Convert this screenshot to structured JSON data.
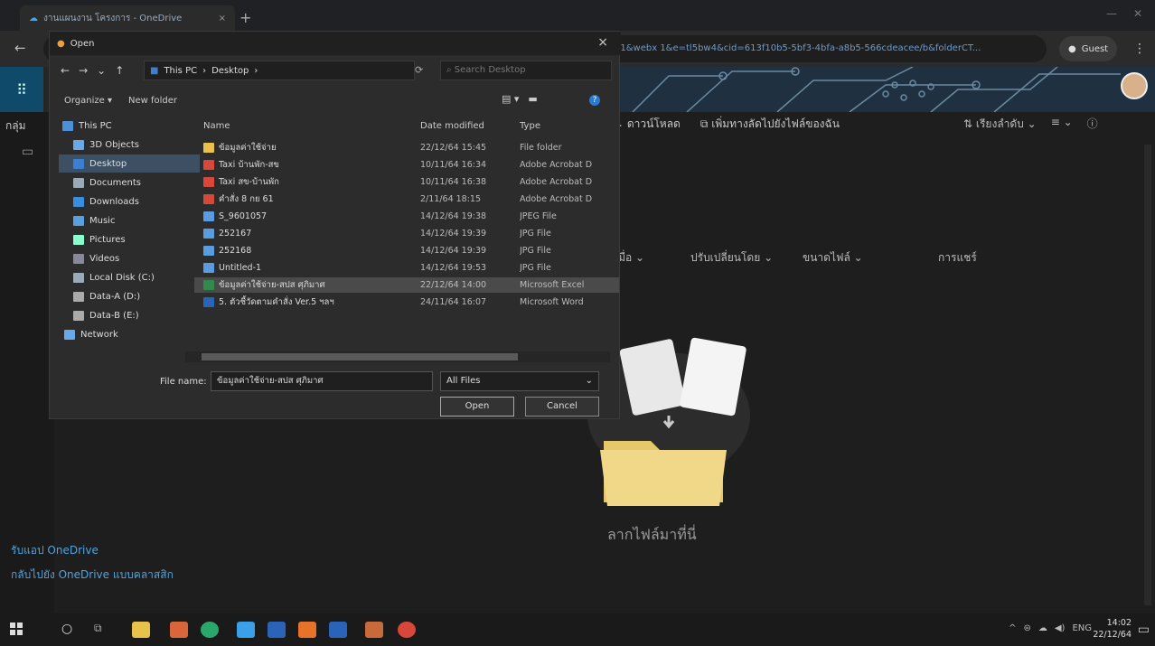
{
  "browser": {
    "tab_title": "งานแผนงาน โครงการ - OneDrive",
    "tab_close": "×",
    "new_tab": "+",
    "address_tail": "=1&webx 1&e=tl5bw4&cid=613f10b5-5bf3-4bfa-a8b5-566cdeacee/b&folderCT...",
    "guest_label": "Guest"
  },
  "onedrive": {
    "groups_label": "กลุ่ม",
    "commands": [
      "ดาวน์โหลด",
      "เพิ่มทางลัดไปยังไฟล์ของฉัน"
    ],
    "sort_label": "เรียงลำดับ",
    "columns": [
      "เมื่อ",
      "ปรับเปลี่ยนโดย",
      "ขนาดไฟล์",
      "การแชร์"
    ],
    "get_app": "รับแอป OneDrive",
    "classic": "กลับไปยัง OneDrive แบบคลาสสิก",
    "drop_here": "ลากไฟล์มาที่นี่"
  },
  "dialog": {
    "title": "Open",
    "close": "×",
    "path": [
      "This PC",
      "Desktop"
    ],
    "search_placeholder": "Search Desktop",
    "organize": "Organize",
    "new_folder": "New folder",
    "help": "?",
    "nav": [
      {
        "label": "This PC",
        "color": "#4f8fd8"
      },
      {
        "label": "3D Objects",
        "color": "#6aa8e8"
      },
      {
        "label": "Desktop",
        "color": "#3c7fd0"
      },
      {
        "label": "Documents",
        "color": "#9ab"
      },
      {
        "label": "Downloads",
        "color": "#3a8ee0"
      },
      {
        "label": "Music",
        "color": "#5aa0e0"
      },
      {
        "label": "Pictures",
        "color": "#8fc"
      },
      {
        "label": "Videos",
        "color": "#889"
      },
      {
        "label": "Local Disk (C:)",
        "color": "#9ab"
      },
      {
        "label": "Data-A (D:)",
        "color": "#aaa"
      },
      {
        "label": "Data-B (E:)",
        "color": "#aaa"
      },
      {
        "label": "Network",
        "color": "#6aa8e8"
      }
    ],
    "headers": {
      "name": "Name",
      "date": "Date modified",
      "type": "Type"
    },
    "files": [
      {
        "name": "ข้อมูลค่าใช้จ่าย",
        "date": "22/12/64 15:45",
        "type": "File folder",
        "icon": "#e8c24a"
      },
      {
        "name": "Taxi บ้านพัก-สข",
        "date": "10/11/64 16:34",
        "type": "Adobe Acrobat D",
        "icon": "#d9463a"
      },
      {
        "name": "Taxi สข-บ้านพัก",
        "date": "10/11/64 16:38",
        "type": "Adobe Acrobat D",
        "icon": "#d9463a"
      },
      {
        "name": "คำสั่ง 8 กย 61",
        "date": "2/11/64 18:15",
        "type": "Adobe Acrobat D",
        "icon": "#d9463a"
      },
      {
        "name": "S_9601057",
        "date": "14/12/64 19:38",
        "type": "JPEG File",
        "icon": "#5b9be0"
      },
      {
        "name": "252167",
        "date": "14/12/64 19:39",
        "type": "JPG File",
        "icon": "#5b9be0"
      },
      {
        "name": "252168",
        "date": "14/12/64 19:39",
        "type": "JPG File",
        "icon": "#5b9be0"
      },
      {
        "name": "Untitled-1",
        "date": "14/12/64 19:53",
        "type": "JPG File",
        "icon": "#5b9be0"
      },
      {
        "name": "ข้อมูลค่าใช้จ่าย-สปส ศุภิมาศ",
        "date": "22/12/64 14:00",
        "type": "Microsoft Excel",
        "icon": "#2f8a4c"
      },
      {
        "name": "5. ตัวชี้วัดตามคำสั่ง Ver.5 ฯลฯ",
        "date": "24/11/64 16:07",
        "type": "Microsoft Word",
        "icon": "#2b63b8"
      }
    ],
    "file_name_label": "File name:",
    "file_name_value": "ข้อมูลค่าใช้จ่าย-สปส ศุภิมาศ",
    "filter": "All Files",
    "open": "Open",
    "cancel": "Cancel"
  },
  "taskbar": {
    "lang": "ENG",
    "time": "14:02",
    "date": "22/12/64"
  }
}
